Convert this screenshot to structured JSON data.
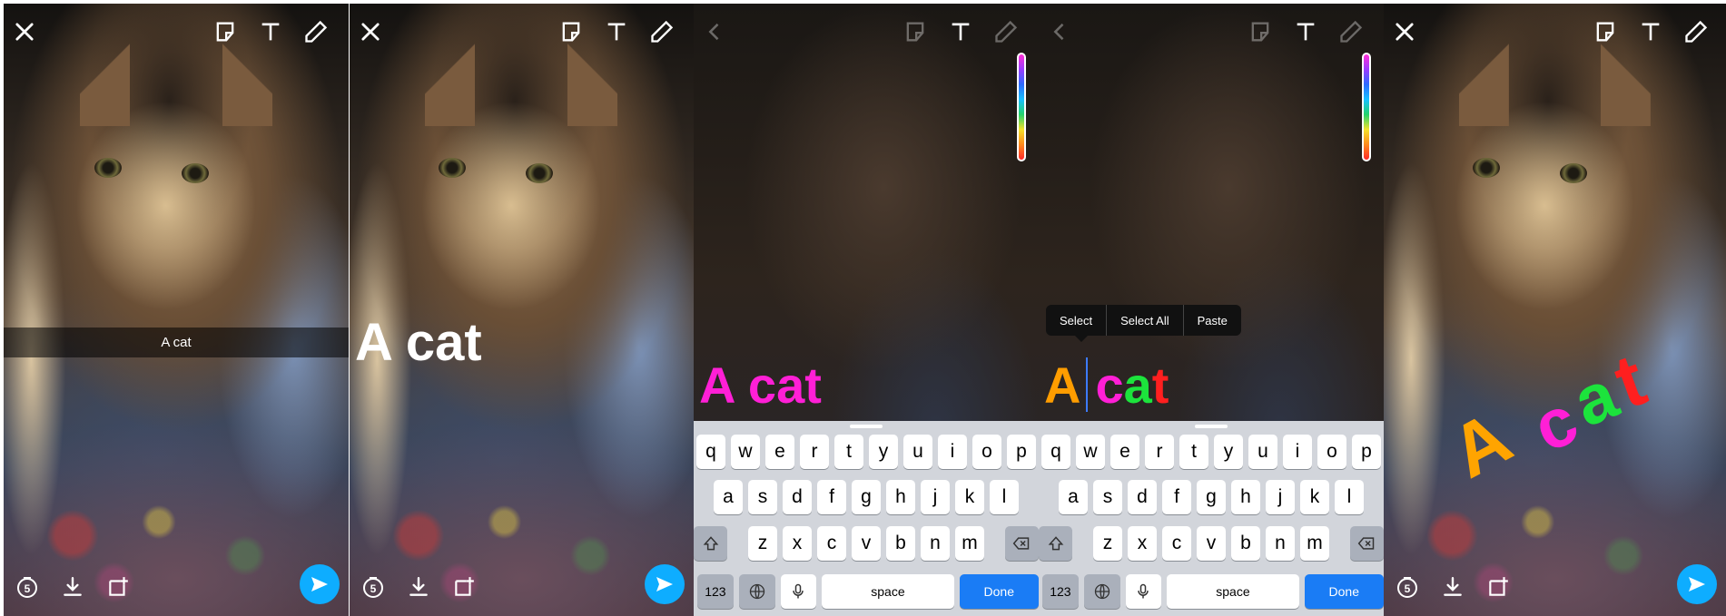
{
  "icons": {
    "close": "close-icon",
    "back": "back-chevron-icon",
    "sticker": "sticker-icon",
    "text": "text-tool-icon",
    "pencil": "pencil-icon",
    "timer": "timer-icon",
    "save": "download-icon",
    "story": "add-to-story-icon",
    "send": "send-arrow-icon"
  },
  "timer_value": "5",
  "panel1": {
    "caption": "A cat"
  },
  "panel2": {
    "caption": "A cat"
  },
  "panel3": {
    "caption": "A cat",
    "caption_color": "#ff1fd6"
  },
  "panel4": {
    "letters": [
      {
        "text": "A",
        "color": "#ff9d00"
      },
      {
        "text": "c",
        "color": "#ff1fd6"
      },
      {
        "text": "a",
        "color": "#1ce33c"
      },
      {
        "text": "t",
        "color": "#ff1f1f"
      }
    ],
    "context_menu": [
      "Select",
      "Select All",
      "Paste"
    ]
  },
  "panel5": {
    "letters": [
      {
        "text": "A",
        "color": "#ffa400"
      },
      {
        "text": "c",
        "color": "#ff1fd6"
      },
      {
        "text": "a",
        "color": "#1ce33c"
      },
      {
        "text": "t",
        "color": "#ff1f1f"
      }
    ]
  },
  "keyboard": {
    "row1": [
      "q",
      "w",
      "e",
      "r",
      "t",
      "y",
      "u",
      "i",
      "o",
      "p"
    ],
    "row2": [
      "a",
      "s",
      "d",
      "f",
      "g",
      "h",
      "j",
      "k",
      "l"
    ],
    "row3": [
      "z",
      "x",
      "c",
      "v",
      "b",
      "n",
      "m"
    ],
    "numbers_key": "123",
    "space_key": "space",
    "done_key": "Done"
  },
  "colors": {
    "send_button": "#0eadff",
    "done_key": "#1a7cf5",
    "keyboard_bg": "#d2d5db"
  }
}
